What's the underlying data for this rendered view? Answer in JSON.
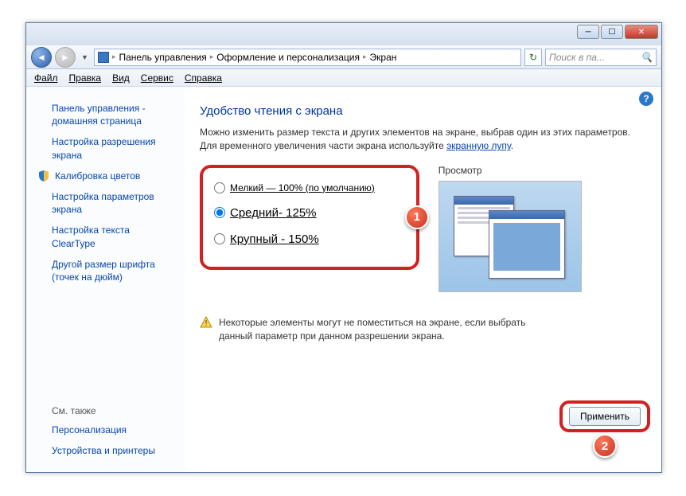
{
  "window_buttons": {
    "min": "─",
    "max": "☐",
    "close": "✕"
  },
  "breadcrumb": {
    "cp": "Панель управления",
    "appearance": "Оформление и персонализация",
    "current": "Экран"
  },
  "search": {
    "placeholder": "Поиск в па...",
    "icon": "🔍"
  },
  "menu": {
    "file": "Файл",
    "edit": "Правка",
    "view": "Вид",
    "tools": "Сервис",
    "help": "Справка"
  },
  "sidebar": {
    "home": "Панель управления - домашняя страница",
    "resolution": "Настройка разрешения экрана",
    "calibrate": "Калибровка цветов",
    "adjust": "Настройка параметров экрана",
    "cleartype": "Настройка текста ClearType",
    "fontsize": "Другой размер шрифта (точек на дюйм)",
    "seealso": "См. также",
    "personalization": "Персонализация",
    "devices": "Устройства и принтеры"
  },
  "main": {
    "title": "Удобство чтения с экрана",
    "desc": "Можно изменить размер текста и других элементов на экране, выбрав один из этих параметров. Для временного увеличения части экрана используйте ",
    "magnifier_link": "экранную лупу",
    "small": "Мелкий — 100% (по умолчанию)",
    "medium": "Средний- 125%",
    "large": "Крупный - 150%",
    "preview": "Просмотр",
    "warn": "Некоторые элементы могут не поместиться на экране, если выбрать данный параметр при данном разрешении экрана.",
    "apply": "Применить"
  },
  "badges": {
    "one": "1",
    "two": "2"
  },
  "help": "?"
}
